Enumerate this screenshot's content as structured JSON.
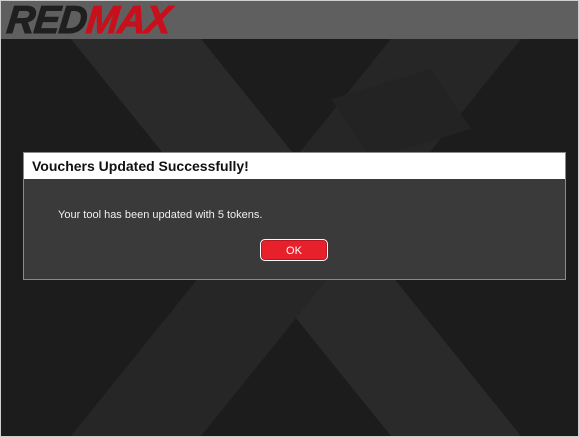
{
  "app": {
    "logo_part_a": "RED",
    "logo_part_b": "MAX"
  },
  "dialog": {
    "title": "Vouchers Updated Successfully!",
    "message": "Your tool has been updated with 5 tokens.",
    "ok_label": "OK"
  },
  "colors": {
    "brand_red": "#c8101c",
    "button_red": "#e8202c",
    "header_gray": "#5f5f5f",
    "background_dark": "#1c1c1c",
    "dialog_body": "#3a3a3a"
  }
}
